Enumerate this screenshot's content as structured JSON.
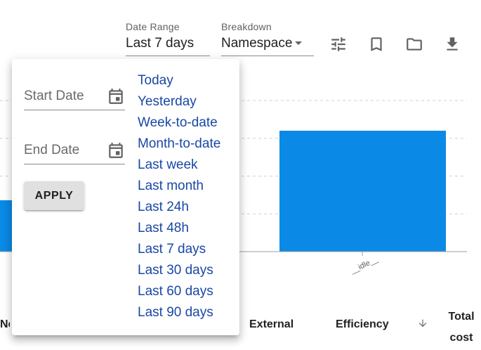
{
  "filters": {
    "date_range": {
      "label": "Date Range",
      "value": "Last 7 days"
    },
    "breakdown": {
      "label": "Breakdown",
      "value": "Namespace"
    }
  },
  "toolbar_icons": [
    "filter-settings-icon",
    "bookmark-icon",
    "folder-icon",
    "download-icon"
  ],
  "date_picker": {
    "start_placeholder": "Start Date",
    "end_placeholder": "End Date",
    "apply_label": "APPLY",
    "presets": [
      "Today",
      "Yesterday",
      "Week-to-date",
      "Month-to-date",
      "Last week",
      "Last month",
      "Last 24h",
      "Last 48h",
      "Last 7 days",
      "Last 30 days",
      "Last 60 days",
      "Last 90 days"
    ]
  },
  "chart_data": {
    "type": "bar",
    "categories": [
      "",
      "__idle__"
    ],
    "values": [
      0.34,
      0.8
    ],
    "grid": true,
    "bar_color": "#0a8ae6"
  },
  "table": {
    "columns": {
      "network": "Netw",
      "external": "External",
      "efficiency": "Efficiency",
      "total_line1": "Total",
      "total_line2": "cost"
    }
  },
  "colors": {
    "accent_link": "#1a47a6",
    "bar": "#0a8ae6"
  }
}
